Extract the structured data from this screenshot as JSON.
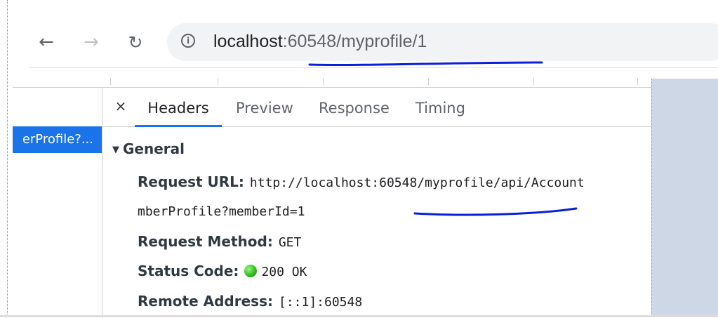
{
  "browser": {
    "back_icon": "←",
    "forward_icon": "→",
    "reload_icon": "↻",
    "info_icon": "i",
    "url_host": "localhost",
    "url_rest": ":60548/myprofile/1"
  },
  "request_list": {
    "selected_item": "erProfile?..."
  },
  "devtools": {
    "close_icon": "×",
    "tabs": [
      "Headers",
      "Preview",
      "Response",
      "Timing"
    ],
    "active_tab": "Headers",
    "section_triangle": "▼",
    "section_title": "General",
    "headers": {
      "request_url_label": "Request URL:",
      "request_url_value": "http://localhost:60548/myprofile/api/Account",
      "request_url_continuation": "mberProfile?memberId=1",
      "request_method_label": "Request Method:",
      "request_method_value": "GET",
      "status_code_label": "Status Code:",
      "status_code_value": "200 OK",
      "remote_address_label": "Remote Address:",
      "remote_address_value": "[::1]:60548"
    }
  },
  "colors": {
    "accent": "#1a73e8",
    "annotation": "#0a1fd6",
    "status_ok": "#2fbf1a",
    "side_panel": "#cdd7e6"
  }
}
